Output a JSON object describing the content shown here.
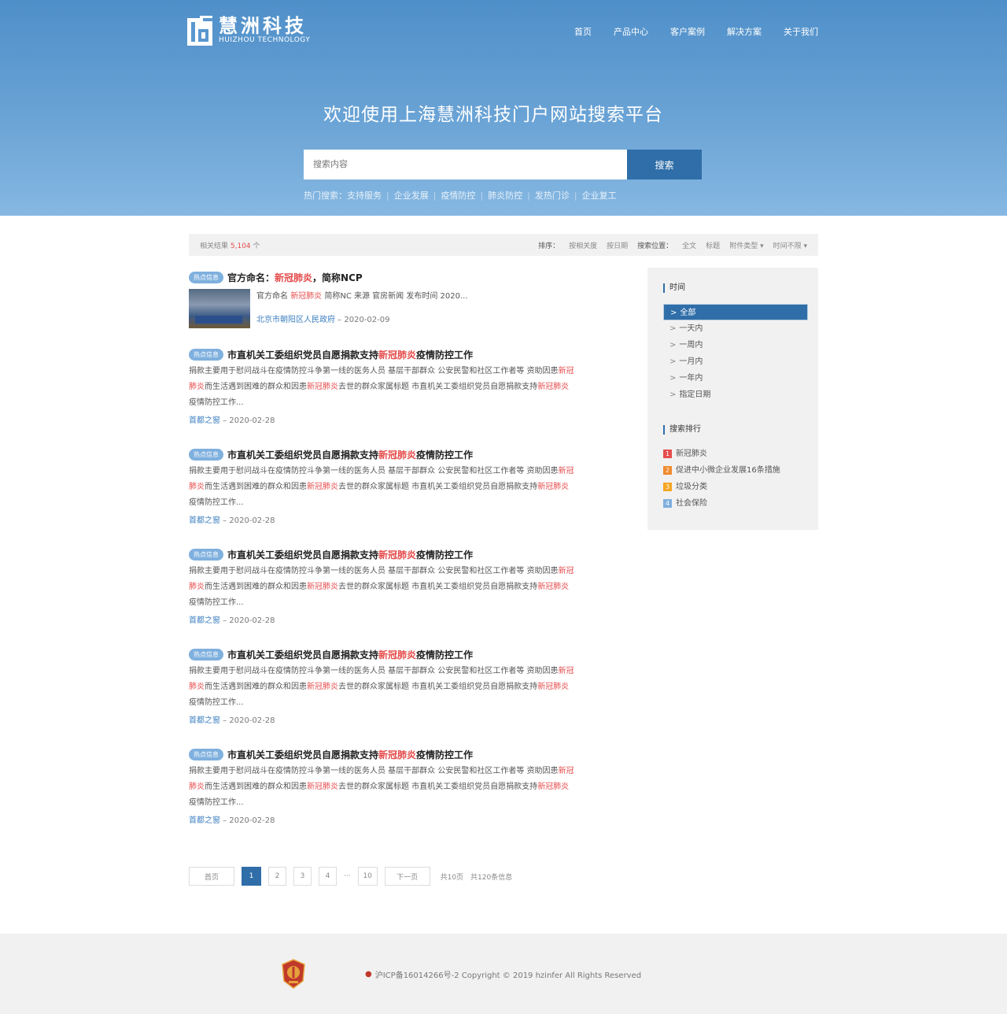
{
  "brand": {
    "name_cn": "慧洲科技",
    "name_en": "HUIZHOU TECHNOLOGY"
  },
  "nav": [
    "首页",
    "产品中心",
    "客户案例",
    "解决方案",
    "关于我们"
  ],
  "hero": {
    "title": "欢迎使用上海慧洲科技门户网站搜索平台",
    "search_placeholder": "搜索内容",
    "search_button": "搜索",
    "hot_label": "热门搜索：",
    "hot_terms": [
      "支持服务",
      "企业发展",
      "疫情防控",
      "肺炎防控",
      "发热门诊",
      "企业复工"
    ]
  },
  "filter": {
    "count_prefix": "相关结果",
    "count": "5,104",
    "count_suffix": "个",
    "sort_label": "排序：",
    "sort_options": [
      "按相关度",
      "按日期"
    ],
    "scope_label": "搜索位置：",
    "scope_options": [
      "全文",
      "标题"
    ],
    "file_type": "附件类型",
    "time_range": "时间不限"
  },
  "results": [
    {
      "badge": "热点信息",
      "title_pre": "官方命名：",
      "title_hl": "新冠肺炎",
      "title_post": "，简称NCP",
      "body_pre": "官方命名 ",
      "body_hl": "新冠肺炎",
      "body_post": " 简称NC 来源 官房新闻 发布时间 2020...",
      "source": "北京市朝阳区人民政府",
      "date": "2020-02-09"
    },
    {
      "badge": "热点信息",
      "title_pre": "市直机关工委组织党员自愿捐款支持",
      "title_hl": "新冠肺炎",
      "title_post": "疫情防控工作",
      "body_l1a": "捐款主要用于慰问战斗在疫情防控斗争第一线的医务人员 基层干部群众 公安民警和社区工作者等 资助因患",
      "body_l1hl": "新冠",
      "body_l2hl": "肺炎",
      "body_l2a": "而生活遇到困难的群众和因患",
      "body_l2hl2": "新冠肺炎",
      "body_l2b": "去世的群众家属标题 市直机关工委组织党员自愿捐款支持",
      "body_l2hl3": "新冠肺炎",
      "body_l3": "疫情防控工作...",
      "source": "首都之窗",
      "date": "2020-02-28"
    },
    {
      "badge": "热点信息",
      "title_pre": "市直机关工委组织党员自愿捐款支持",
      "title_hl": "新冠肺炎",
      "title_post": "疫情防控工作",
      "body_l1a": "捐款主要用于慰问战斗在疫情防控斗争第一线的医务人员 基层干部群众 公安民警和社区工作者等 资助因患",
      "body_l1hl": "新冠",
      "body_l2hl": "肺炎",
      "body_l2a": "而生活遇到困难的群众和因患",
      "body_l2hl2": "新冠肺炎",
      "body_l2b": "去世的群众家属标题 市直机关工委组织党员自愿捐款支持",
      "body_l2hl3": "新冠肺炎",
      "body_l3": "疫情防控工作...",
      "source": "首都之窗",
      "date": "2020-02-28"
    },
    {
      "badge": "热点信息",
      "title_pre": "市直机关工委组织党员自愿捐款支持",
      "title_hl": "新冠肺炎",
      "title_post": "疫情防控工作",
      "body_l1a": "捐款主要用于慰问战斗在疫情防控斗争第一线的医务人员 基层干部群众 公安民警和社区工作者等 资助因患",
      "body_l1hl": "新冠",
      "body_l2hl": "肺炎",
      "body_l2a": "而生活遇到困难的群众和因患",
      "body_l2hl2": "新冠肺炎",
      "body_l2b": "去世的群众家属标题 市直机关工委组织党员自愿捐款支持",
      "body_l2hl3": "新冠肺炎",
      "body_l3": "疫情防控工作...",
      "source": "首都之窗",
      "date": "2020-02-28"
    },
    {
      "badge": "热点信息",
      "title_pre": "市直机关工委组织党员自愿捐款支持",
      "title_hl": "新冠肺炎",
      "title_post": "疫情防控工作",
      "body_l1a": "捐款主要用于慰问战斗在疫情防控斗争第一线的医务人员 基层干部群众 公安民警和社区工作者等 资助因患",
      "body_l1hl": "新冠",
      "body_l2hl": "肺炎",
      "body_l2a": "而生活遇到困难的群众和因患",
      "body_l2hl2": "新冠肺炎",
      "body_l2b": "去世的群众家属标题 市直机关工委组织党员自愿捐款支持",
      "body_l2hl3": "新冠肺炎",
      "body_l3": "疫情防控工作...",
      "source": "首都之窗",
      "date": "2020-02-28"
    },
    {
      "badge": "热点信息",
      "title_pre": "市直机关工委组织党员自愿捐款支持",
      "title_hl": "新冠肺炎",
      "title_post": "疫情防控工作",
      "body_l1a": "捐款主要用于慰问战斗在疫情防控斗争第一线的医务人员 基层干部群众 公安民警和社区工作者等 资助因患",
      "body_l1hl": "新冠",
      "body_l2hl": "肺炎",
      "body_l2a": "而生活遇到困难的群众和因患",
      "body_l2hl2": "新冠肺炎",
      "body_l2b": "去世的群众家属标题 市直机关工委组织党员自愿捐款支持",
      "body_l2hl3": "新冠肺炎",
      "body_l3": "疫情防控工作...",
      "source": "首都之窗",
      "date": "2020-02-28"
    }
  ],
  "sidebar": {
    "time_head": "时间",
    "time_options": [
      "全部",
      "一天内",
      "一周内",
      "一月内",
      "一年内",
      "指定日期"
    ],
    "rank_head": "搜索排行",
    "rank_items": [
      {
        "n": "1",
        "label": "新冠肺炎",
        "color": "#e64c4c"
      },
      {
        "n": "2",
        "label": "促进中小微企业发展16条措施",
        "color": "#f08a2e"
      },
      {
        "n": "3",
        "label": "垃圾分类",
        "color": "#f5a623"
      },
      {
        "n": "4",
        "label": "社会保险",
        "color": "#7fb0de"
      }
    ]
  },
  "pager": {
    "first": "首页",
    "pages": [
      "1",
      "2",
      "3",
      "4"
    ],
    "ellipsis": "···",
    "last_page": "10",
    "next": "下一页",
    "total_pages": "共10页",
    "total_items": "共120条信息"
  },
  "footer": {
    "copyright": "沪ICP备16014266号-2 Copyright © 2019 hzinfer All Rights Reserved"
  },
  "colors": {
    "accent": "#2f6ea8",
    "highlight": "#e64c4c",
    "badge": "#7fb0de"
  }
}
